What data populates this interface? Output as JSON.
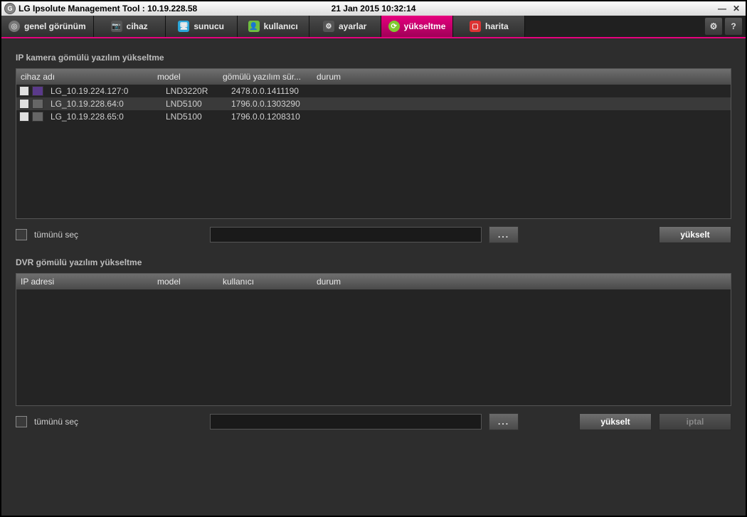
{
  "titlebar": {
    "title": "LG Ipsolute Management Tool : 10.19.228.58",
    "datetime": "21 Jan 2015 10:32:14"
  },
  "tabs": [
    {
      "label": "genel görünüm",
      "icon_color": "#777"
    },
    {
      "label": "cihaz",
      "icon_color": "#555"
    },
    {
      "label": "sunucu",
      "icon_color": "#2aa5d8"
    },
    {
      "label": "kullanıcı",
      "icon_color": "#6fbf3f"
    },
    {
      "label": "ayarlar",
      "icon_color": "#555"
    },
    {
      "label": "yükseltme",
      "icon_color": "#7fca2f",
      "active": true
    },
    {
      "label": "harita",
      "icon_color": "#d33"
    }
  ],
  "section1": {
    "title": "IP kamera gömülü yazılım yükseltme",
    "columns": {
      "name": "cihaz adı",
      "model": "model",
      "fw": "gömülü yazılım sür...",
      "status": "durum"
    },
    "rows": [
      {
        "name": "LG_10.19.224.127:0",
        "model": "LND3220R",
        "fw": "2478.0.0.1411190",
        "status": "",
        "cam": "purple"
      },
      {
        "name": "LG_10.19.228.64:0",
        "model": "LND5100",
        "fw": "1796.0.0.1303290",
        "status": "",
        "cam": "gray"
      },
      {
        "name": "LG_10.19.228.65:0",
        "model": "LND5100",
        "fw": "1796.0.0.1208310",
        "status": "",
        "cam": "gray"
      }
    ],
    "select_all": "tümünü seç",
    "browse": "...",
    "upgrade": "yükselt"
  },
  "section2": {
    "title": "DVR gömülü yazılım yükseltme",
    "columns": {
      "ip": "IP adresi",
      "model": "model",
      "user": "kullanıcı",
      "status": "durum"
    },
    "rows": [],
    "select_all": "tümünü seç",
    "browse": "...",
    "upgrade": "yükselt",
    "cancel": "iptal"
  }
}
